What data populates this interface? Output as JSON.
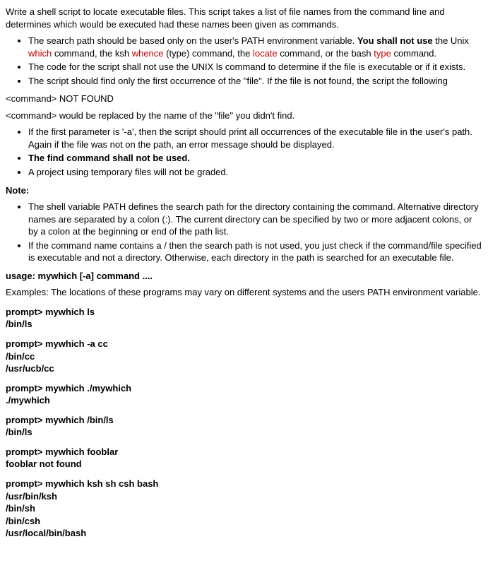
{
  "intro": "Write a shell script to locate executable files. This script takes a list of file names from the command line and determines which would be executed had these names been given as commands.",
  "b1_a": "The search path should be based only on the user's PATH environment variable. ",
  "b1_b": "You shall not use",
  "b1_c": " the Unix ",
  "b1_which": "which",
  "b1_d": " command, the ksh ",
  "b1_whence": "whence",
  "b1_e": " (type) command, the ",
  "b1_locate": "locate",
  "b1_f": " command, or the bash ",
  "b1_type": "type",
  "b1_g": " command.",
  "b2": "The code for the script shall not use the UNIX ls command to determine if the file is executable or if it exists.",
  "b3": "The script should find only the first occurrence of the \"file\". If the file is not found, the script  the following",
  "notfound": "<command> NOT FOUND",
  "replaced": "<command> would be replaced by the name of the \"file\" you didn't find.",
  "b4": "If the first parameter is '-a', then the script should print all occurrences of the executable file in the user's path. Again if the file was not on the path, an error message should be displayed.",
  "b5": "The find command shall not be used.",
  "b6": "A project using  temporary files will not be graded.",
  "note_label": "Note:",
  "n1": "The shell variable PATH defines the search path for the directory containing the command. Alternative directory names are separated by a colon (:). The current directory can be specified by two or more adjacent colons, or by a colon at the beginning or end of the path list.",
  "n2": "If the command name contains a / then the search path is not used, you just check if the command/file specified is executable and not a directory. Otherwise, each directory in the path is searched for an executable file.",
  "usage": "usage: mywhich [-a] command ....",
  "examples_intro": "Examples: The locations of these programs may vary on different systems and the users PATH environment variable.",
  "ex1_cmd": "prompt> mywhich ls",
  "ex1_out": "/bin/ls",
  "ex2_cmd": "prompt> mywhich -a cc",
  "ex2_out1": "/bin/cc",
  "ex2_out2": "/usr/ucb/cc",
  "ex3_cmd": "prompt> mywhich ./mywhich",
  "ex3_out": "./mywhich",
  "ex4_cmd": "prompt> mywhich /bin/ls",
  "ex4_out": "/bin/ls",
  "ex5_cmd": "prompt> mywhich fooblar",
  "ex5_out": "fooblar not found",
  "ex6_cmd": "prompt> mywhich ksh sh csh bash",
  "ex6_out1": "/usr/bin/ksh",
  "ex6_out2": "/bin/sh",
  "ex6_out3": "/bin/csh",
  "ex6_out4": "/usr/local/bin/bash"
}
